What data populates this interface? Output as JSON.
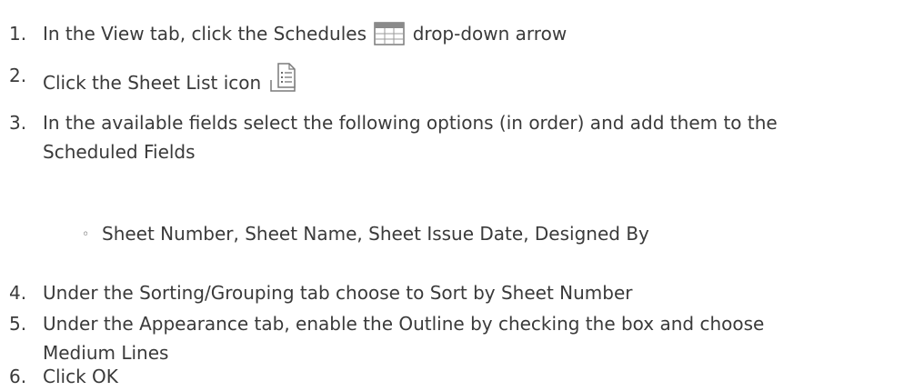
{
  "steps": [
    {
      "number": "1.",
      "before": "In the View tab, click the Schedules",
      "icon": "schedules-table-icon",
      "after": "drop-down arrow"
    },
    {
      "number": "2.",
      "before": "Click the Sheet List icon",
      "icon": "sheet-list-icon"
    },
    {
      "number": "3.",
      "line1": "In the available fields select the following options (in order) and add them to the",
      "line2": "Scheduled Fields",
      "sub_bullet": "Sheet Number, Sheet Name, Sheet Issue Date, Designed By"
    },
    {
      "number": "4.",
      "text": "Under the Sorting/Grouping tab choose to Sort by Sheet Number"
    },
    {
      "number": "5.",
      "line1": "Under the Appearance tab, enable the Outline by checking the box and choose",
      "line2": "Medium Lines"
    },
    {
      "number": "6.",
      "text": "Click OK"
    }
  ],
  "colors": {
    "text": "#3a3a3a",
    "icon_header": "#8a8a8a",
    "icon_border": "#7a7a7a"
  }
}
